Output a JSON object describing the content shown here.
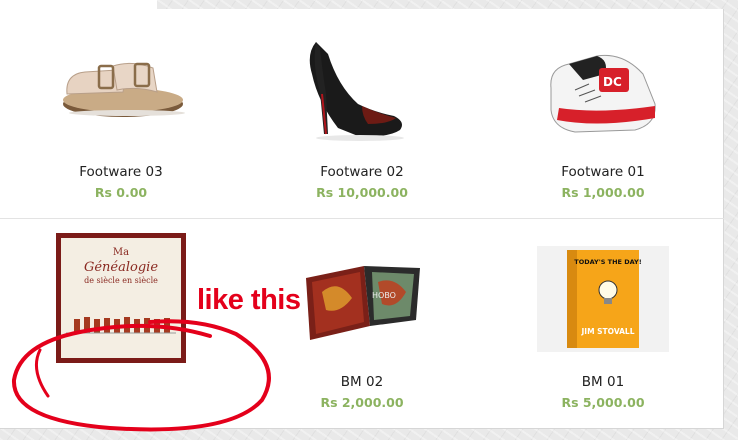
{
  "products": [
    {
      "name": "Footware 03",
      "price": "Rs 0.00",
      "icon": "sandal-image"
    },
    {
      "name": "Footware 02",
      "price": "Rs 10,000.00",
      "icon": "high-heel-image"
    },
    {
      "name": "Footware 01",
      "price": "Rs 1,000.00",
      "icon": "sneaker-image"
    },
    {
      "name": "",
      "price": "",
      "icon": "genealogy-book-image",
      "cover": {
        "title_line1": "Ma",
        "title_line2": "Généalogie",
        "title_line3": "de siècle en siècle"
      }
    },
    {
      "name": "BM 02",
      "price": "Rs 2,000.00",
      "icon": "art-book-image",
      "cover": {
        "text": "HOBO"
      }
    },
    {
      "name": "BM 01",
      "price": "Rs 5,000.00",
      "icon": "todays-the-day-book-image",
      "cover": {
        "title": "TODAY'S THE DAY!",
        "author": "JIM STOVALL"
      }
    }
  ],
  "annotation": {
    "text": "like this",
    "color": "#e4001b"
  },
  "colors": {
    "price": "#8cb360",
    "annotation": "#e4001b"
  }
}
